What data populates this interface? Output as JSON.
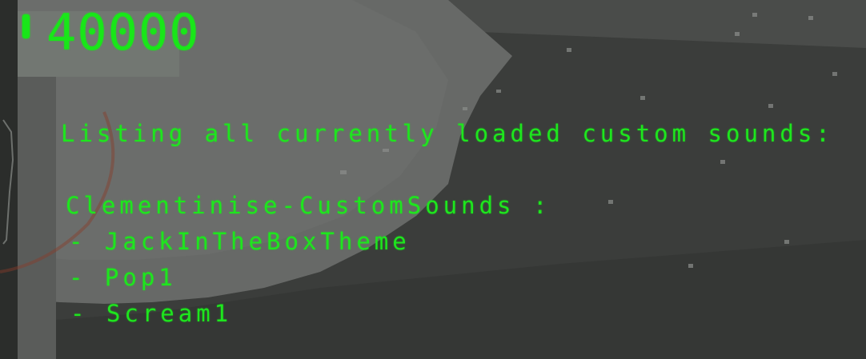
{
  "hud": {
    "counter_value": "40000"
  },
  "console": {
    "header": "Listing all currently loaded custom sounds:",
    "mod_name": "Clementinise-CustomSounds :",
    "sounds": [
      "- JackInTheBoxTheme",
      "- Pop1",
      "- Scream1"
    ]
  },
  "colors": {
    "console_text": "#1ee61e",
    "hud_text": "#19e619",
    "background": "#3a3c3a"
  }
}
